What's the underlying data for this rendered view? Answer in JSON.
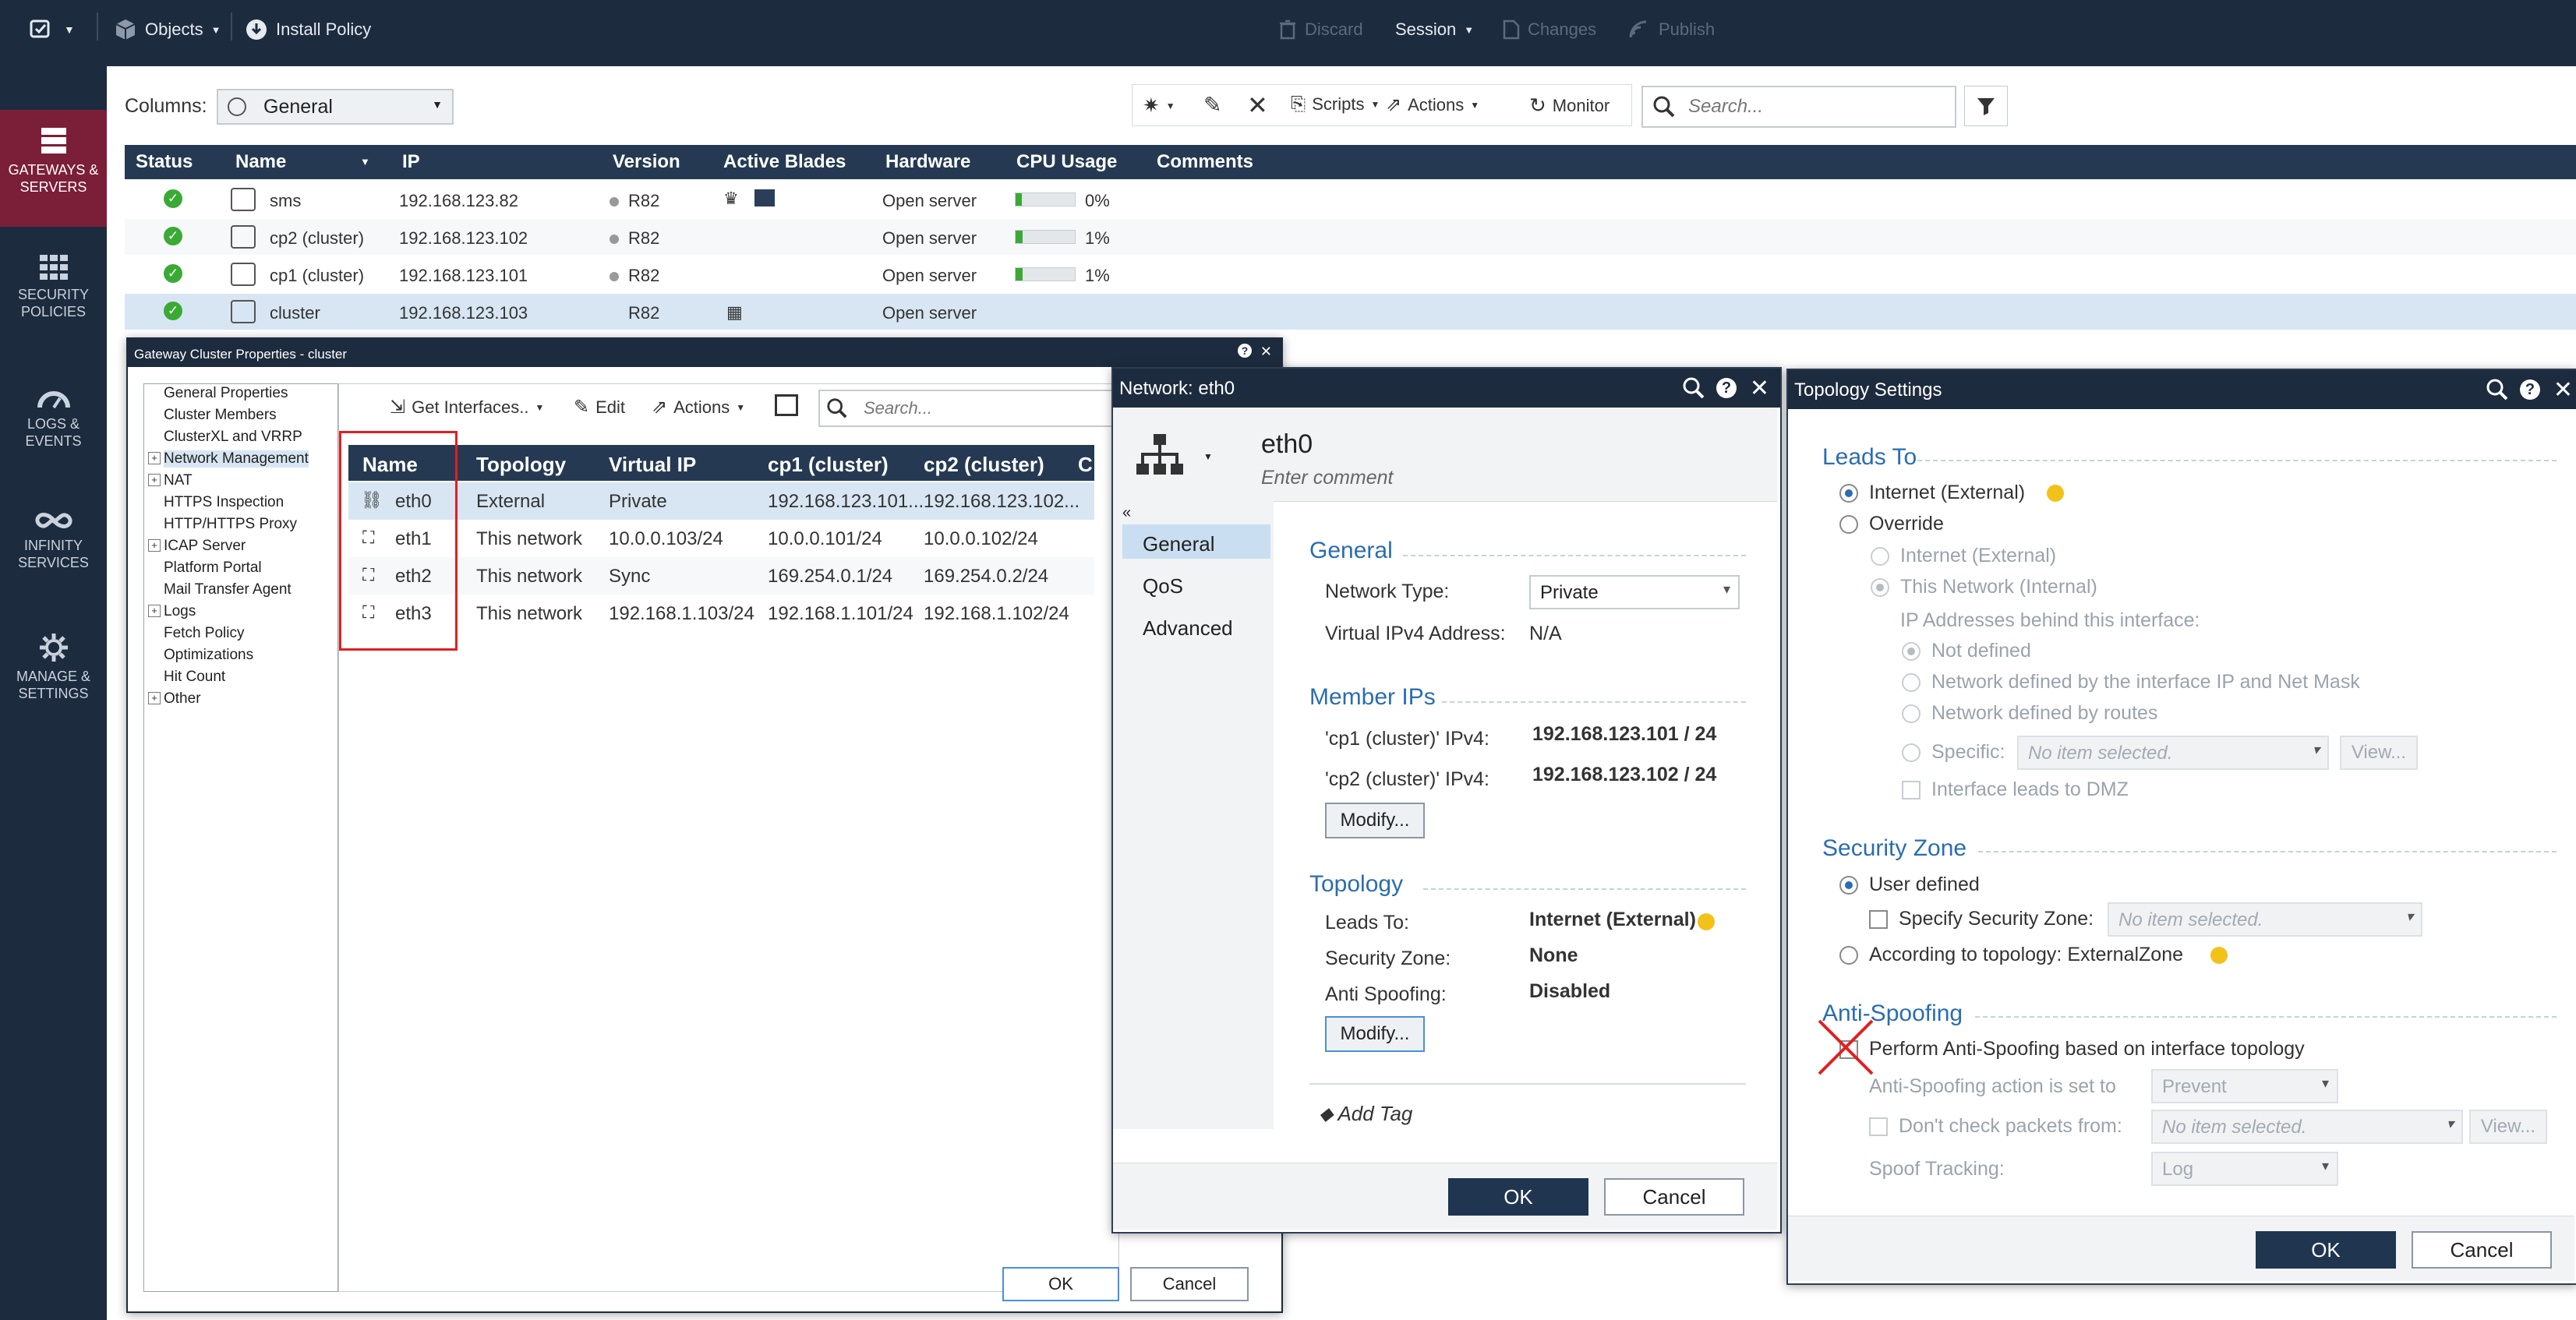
{
  "topbar": {
    "objects": "Objects",
    "install_policy": "Install Policy",
    "discard": "Discard",
    "session": "Session",
    "changes": "Changes",
    "publish": "Publish"
  },
  "sidebar": {
    "items": [
      {
        "label": "GATEWAYS & SERVERS"
      },
      {
        "label": "SECURITY POLICIES"
      },
      {
        "label": "LOGS & EVENTS"
      },
      {
        "label": "INFINITY SERVICES"
      },
      {
        "label": "MANAGE & SETTINGS"
      }
    ]
  },
  "toolbar": {
    "columns_label": "Columns:",
    "columns_value": "General",
    "scripts": "Scripts",
    "actions": "Actions",
    "monitor": "Monitor",
    "search_placeholder": "Search..."
  },
  "grid": {
    "headers": [
      "Status",
      "Name",
      "IP",
      "Version",
      "Active Blades",
      "Hardware",
      "CPU Usage",
      "Comments"
    ],
    "rows": [
      {
        "name": "sms",
        "ip": "192.168.123.82",
        "version": "R82",
        "hardware": "Open server",
        "cpu": "0%",
        "cpu_fill": 0.1
      },
      {
        "name": "cp2 (cluster)",
        "ip": "192.168.123.102",
        "version": "R82",
        "hardware": "Open server",
        "cpu": "1%",
        "cpu_fill": 0.12
      },
      {
        "name": "cp1 (cluster)",
        "ip": "192.168.123.101",
        "version": "R82",
        "hardware": "Open server",
        "cpu": "1%",
        "cpu_fill": 0.12
      },
      {
        "name": "cluster",
        "ip": "192.168.123.103",
        "version": "R82",
        "hardware": "Open server",
        "cpu": "",
        "cpu_fill": 0
      }
    ]
  },
  "cluster_win": {
    "title": "Gateway Cluster Properties - cluster",
    "tree": [
      {
        "label": "General Properties",
        "exp": false
      },
      {
        "label": "Cluster Members",
        "exp": false
      },
      {
        "label": "ClusterXL and VRRP",
        "exp": false
      },
      {
        "label": "Network Management",
        "exp": true
      },
      {
        "label": "NAT",
        "exp": true
      },
      {
        "label": "HTTPS Inspection",
        "exp": false
      },
      {
        "label": "HTTP/HTTPS Proxy",
        "exp": false
      },
      {
        "label": "ICAP Server",
        "exp": true
      },
      {
        "label": "Platform Portal",
        "exp": false
      },
      {
        "label": "Mail Transfer Agent",
        "exp": false
      },
      {
        "label": "Logs",
        "exp": true
      },
      {
        "label": "Fetch Policy",
        "exp": false
      },
      {
        "label": "Optimizations",
        "exp": false
      },
      {
        "label": "Hit Count",
        "exp": false
      },
      {
        "label": "Other",
        "exp": true
      }
    ],
    "get_interfaces": "Get Interfaces..",
    "edit": "Edit",
    "actions": "Actions",
    "search_placeholder": "Search...",
    "if_headers": [
      "Name",
      "Topology",
      "Virtual IP",
      "cp1 (cluster)",
      "cp2 (cluster)",
      "C"
    ],
    "if_rows": [
      {
        "name": "eth0",
        "topology": "External",
        "vip": "Private",
        "cp1": "192.168.123.101...",
        "cp2": "192.168.123.102..."
      },
      {
        "name": "eth1",
        "topology": "This network",
        "vip": "10.0.0.103/24",
        "cp1": "10.0.0.101/24",
        "cp2": "10.0.0.102/24"
      },
      {
        "name": "eth2",
        "topology": "This network",
        "vip": "Sync",
        "cp1": "169.254.0.1/24",
        "cp2": "169.254.0.2/24"
      },
      {
        "name": "eth3",
        "topology": "This network",
        "vip": "192.168.1.103/24",
        "cp1": "192.168.1.101/24",
        "cp2": "192.168.1.102/24"
      }
    ],
    "ok": "OK",
    "cancel": "Cancel"
  },
  "network_win": {
    "title": "Network: eth0",
    "name": "eth0",
    "comment_placeholder": "Enter comment",
    "nav": [
      "General",
      "QoS",
      "Advanced"
    ],
    "general_title": "General",
    "network_type_label": "Network Type:",
    "network_type_value": "Private",
    "vipv4_label": "Virtual IPv4 Address:",
    "vipv4_value": "N/A",
    "member_ips_title": "Member IPs",
    "cp1_label": "'cp1 (cluster)' IPv4:",
    "cp1_value": "192.168.123.101 / 24",
    "cp2_label": "'cp2 (cluster)' IPv4:",
    "cp2_value": "192.168.123.102 / 24",
    "modify": "Modify...",
    "topology_title": "Topology",
    "leads_to_label": "Leads To:",
    "leads_to_value": "Internet (External)",
    "security_zone_label": "Security Zone:",
    "security_zone_value": "None",
    "anti_spoofing_label": "Anti Spoofing:",
    "anti_spoofing_value": "Disabled",
    "add_tag": "Add Tag",
    "ok": "OK",
    "cancel": "Cancel"
  },
  "topology_win": {
    "title": "Topology Settings",
    "leads_to_title": "Leads To",
    "internet_external": "Internet (External)",
    "override": "Override",
    "ov_internet": "Internet (External)",
    "ov_this_network": "This Network (Internal)",
    "ip_behind": "IP Addresses behind this interface:",
    "not_defined": "Not defined",
    "net_by_ip": "Network defined by the interface IP and Net Mask",
    "net_by_routes": "Network defined by routes",
    "specific": "Specific:",
    "no_item": "No item selected.",
    "view": "View...",
    "leads_dmz": "Interface leads to DMZ",
    "security_zone_title": "Security Zone",
    "user_defined": "User defined",
    "specify_zone": "Specify Security Zone:",
    "according_topology": "According to topology: ExternalZone",
    "anti_spoofing_title": "Anti-Spoofing",
    "perform_anti_spoofing": "Perform Anti-Spoofing based on interface topology",
    "action_set_to": "Anti-Spoofing action is set to",
    "prevent": "Prevent",
    "dont_check": "Don't check packets from:",
    "spoof_tracking": "Spoof Tracking:",
    "log": "Log",
    "ok": "OK",
    "cancel": "Cancel"
  },
  "colors": {
    "nav_bg": "#1d2b3e",
    "active_nav": "#7b1e38",
    "accent_blue": "#2a6db0",
    "status_green": "#3aaa35",
    "annotation_red": "#e02020"
  }
}
